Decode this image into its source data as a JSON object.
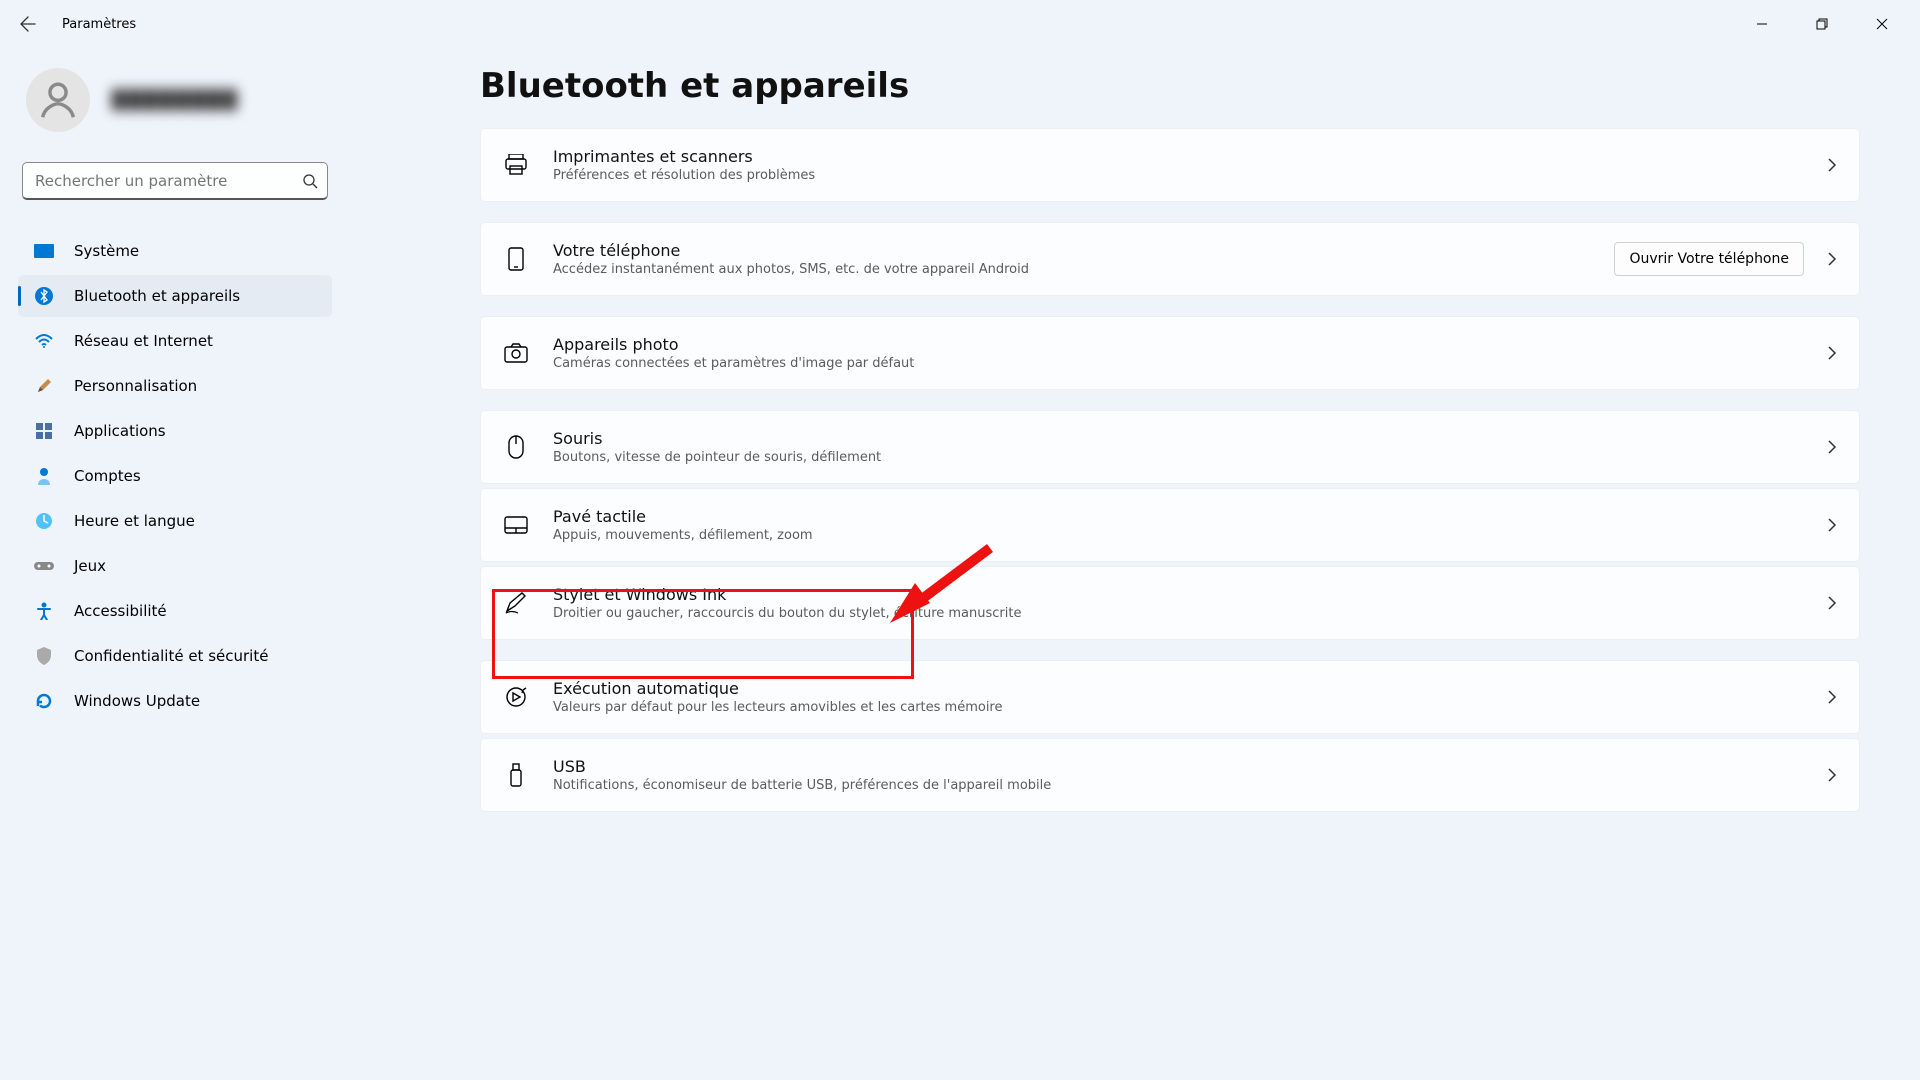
{
  "window": {
    "title": "Paramètres"
  },
  "account": {
    "display_name": "████████"
  },
  "search": {
    "placeholder": "Rechercher un paramètre"
  },
  "sidebar": [
    {
      "id": "system",
      "label": "Système",
      "active": false
    },
    {
      "id": "bluetooth",
      "label": "Bluetooth et appareils",
      "active": true
    },
    {
      "id": "network",
      "label": "Réseau et Internet",
      "active": false
    },
    {
      "id": "personalization",
      "label": "Personnalisation",
      "active": false
    },
    {
      "id": "apps",
      "label": "Applications",
      "active": false
    },
    {
      "id": "accounts",
      "label": "Comptes",
      "active": false
    },
    {
      "id": "time",
      "label": "Heure et langue",
      "active": false
    },
    {
      "id": "gaming",
      "label": "Jeux",
      "active": false
    },
    {
      "id": "accessibility",
      "label": "Accessibilité",
      "active": false
    },
    {
      "id": "privacy",
      "label": "Confidentialité et sécurité",
      "active": false
    },
    {
      "id": "update",
      "label": "Windows Update",
      "active": false
    }
  ],
  "page": {
    "title": "Bluetooth et appareils"
  },
  "cards": [
    {
      "id": "printers",
      "title": "Imprimantes et scanners",
      "desc": "Préférences et résolution des problèmes"
    },
    {
      "id": "phone",
      "title": "Votre téléphone",
      "desc": "Accédez instantanément aux photos, SMS, etc. de votre appareil Android",
      "button": "Ouvrir Votre téléphone"
    },
    {
      "id": "cameras",
      "title": "Appareils photo",
      "desc": "Caméras connectées et paramètres d'image par défaut"
    },
    {
      "id": "mouse",
      "title": "Souris",
      "desc": "Boutons, vitesse de pointeur de souris, défilement"
    },
    {
      "id": "touchpad",
      "title": "Pavé tactile",
      "desc": "Appuis, mouvements, défilement, zoom"
    },
    {
      "id": "pen",
      "title": "Stylet et Windows Ink",
      "desc": "Droitier ou gaucher, raccourcis du bouton du stylet, écriture manuscrite"
    },
    {
      "id": "autoplay",
      "title": "Exécution automatique",
      "desc": "Valeurs par défaut pour les lecteurs amovibles et les cartes mémoire"
    },
    {
      "id": "usb",
      "title": "USB",
      "desc": "Notifications, économiseur de batterie USB, préférences de l'appareil mobile"
    }
  ]
}
